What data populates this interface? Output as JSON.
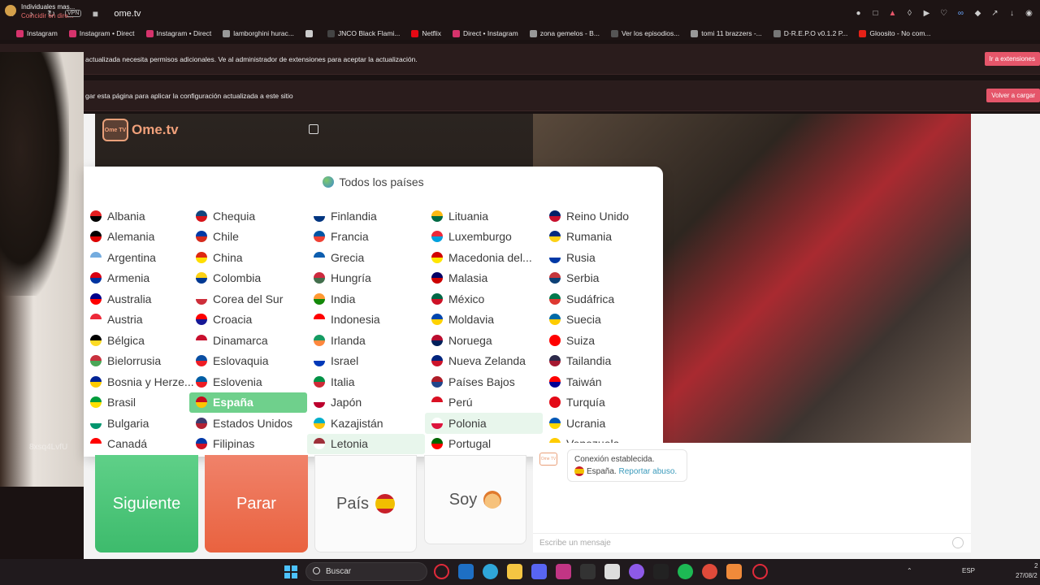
{
  "browser": {
    "url": "ome.tv",
    "vpn_label": "VPN",
    "bookmarks": [
      {
        "label": "Instagram",
        "color": "#d6336c"
      },
      {
        "label": "Instagram • Direct",
        "color": "#d6336c"
      },
      {
        "label": "Instagram • Direct",
        "color": "#d6336c"
      },
      {
        "label": "lamborghini hurac...",
        "color": "#999999"
      },
      {
        "label": "",
        "color": "#cccccc"
      },
      {
        "label": "JNCO Black Flami...",
        "color": "#444444"
      },
      {
        "label": "Netflix",
        "color": "#e50914"
      },
      {
        "label": "Direct • Instagram",
        "color": "#d6336c"
      },
      {
        "label": "zona gemelos - B...",
        "color": "#999999"
      },
      {
        "label": "Ver los episodios...",
        "color": "#555555"
      },
      {
        "label": "tomi 11 brazzers -...",
        "color": "#999999"
      },
      {
        "label": "D·R.E.P.O v0.1.2 P...",
        "color": "#777777"
      },
      {
        "label": "Gloosito - No com...",
        "color": "#e62117"
      }
    ]
  },
  "infobars": {
    "extensions_text": "actualizada necesita permisos adicionales. Ve al administrador de extensiones para aceptar la actualización.",
    "extensions_button": "Ir a extensiones",
    "reload_text": "gar esta página para aplicar la configuración actualizada a este sitio",
    "reload_button": "Volver a cargar"
  },
  "logo": {
    "tv_label": "Ome TV",
    "text": "Ome.tv"
  },
  "webcam": {
    "code": "8xsq4LvfU"
  },
  "countries": {
    "header": "Todos los países",
    "selected": "España",
    "hover": "Polonia",
    "hover2": "Letonia",
    "columns": [
      [
        {
          "name": "Albania",
          "c1": "#e41e20",
          "c2": "#000000"
        },
        {
          "name": "Alemania",
          "c1": "#000000",
          "c2": "#dd0000"
        },
        {
          "name": "Argentina",
          "c1": "#74acdf",
          "c2": "#ffffff"
        },
        {
          "name": "Armenia",
          "c1": "#d90012",
          "c2": "#0033a0"
        },
        {
          "name": "Australia",
          "c1": "#00008b",
          "c2": "#ff0000"
        },
        {
          "name": "Austria",
          "c1": "#ed2939",
          "c2": "#ffffff"
        },
        {
          "name": "Bélgica",
          "c1": "#000000",
          "c2": "#fdda24"
        },
        {
          "name": "Bielorrusia",
          "c1": "#c8313e",
          "c2": "#4aa657"
        },
        {
          "name": "Bosnia y Herze...",
          "c1": "#002395",
          "c2": "#fecb00"
        },
        {
          "name": "Brasil",
          "c1": "#009c3b",
          "c2": "#ffdf00"
        },
        {
          "name": "Bulgaria",
          "c1": "#ffffff",
          "c2": "#00966e"
        },
        {
          "name": "Canadá",
          "c1": "#ff0000",
          "c2": "#ffffff"
        }
      ],
      [
        {
          "name": "Chequia",
          "c1": "#11457e",
          "c2": "#d7141a"
        },
        {
          "name": "Chile",
          "c1": "#0039a6",
          "c2": "#d52b1e"
        },
        {
          "name": "China",
          "c1": "#de2910",
          "c2": "#ffde00"
        },
        {
          "name": "Colombia",
          "c1": "#fcd116",
          "c2": "#003893"
        },
        {
          "name": "Corea del Sur",
          "c1": "#ffffff",
          "c2": "#cd2e3a"
        },
        {
          "name": "Croacia",
          "c1": "#ff0000",
          "c2": "#171796"
        },
        {
          "name": "Dinamarca",
          "c1": "#c8102e",
          "c2": "#ffffff"
        },
        {
          "name": "Eslovaquia",
          "c1": "#0b4ea2",
          "c2": "#ee1c25"
        },
        {
          "name": "Eslovenia",
          "c1": "#005da4",
          "c2": "#ed1c24"
        },
        {
          "name": "España",
          "c1": "#c60b1e",
          "c2": "#ffc400"
        },
        {
          "name": "Estados Unidos",
          "c1": "#3c3b6e",
          "c2": "#b22234"
        },
        {
          "name": "Filipinas",
          "c1": "#0038a8",
          "c2": "#ce1126"
        }
      ],
      [
        {
          "name": "Finlandia",
          "c1": "#ffffff",
          "c2": "#003580"
        },
        {
          "name": "Francia",
          "c1": "#0055a4",
          "c2": "#ef4135"
        },
        {
          "name": "Grecia",
          "c1": "#0d5eaf",
          "c2": "#ffffff"
        },
        {
          "name": "Hungría",
          "c1": "#cd2a3e",
          "c2": "#436f4d"
        },
        {
          "name": "India",
          "c1": "#ff9933",
          "c2": "#138808"
        },
        {
          "name": "Indonesia",
          "c1": "#ff0000",
          "c2": "#ffffff"
        },
        {
          "name": "Irlanda",
          "c1": "#169b62",
          "c2": "#ff883e"
        },
        {
          "name": "Israel",
          "c1": "#ffffff",
          "c2": "#0038b8"
        },
        {
          "name": "Italia",
          "c1": "#009246",
          "c2": "#ce2b37"
        },
        {
          "name": "Japón",
          "c1": "#ffffff",
          "c2": "#bc002d"
        },
        {
          "name": "Kazajistán",
          "c1": "#00afca",
          "c2": "#fec50c"
        },
        {
          "name": "Letonia",
          "c1": "#9e3039",
          "c2": "#ffffff"
        }
      ],
      [
        {
          "name": "Lituania",
          "c1": "#fdb913",
          "c2": "#006a44"
        },
        {
          "name": "Luxemburgo",
          "c1": "#ed2939",
          "c2": "#00a1de"
        },
        {
          "name": "Macedonia del...",
          "c1": "#d20000",
          "c2": "#ffe600"
        },
        {
          "name": "Malasia",
          "c1": "#010066",
          "c2": "#cc0001"
        },
        {
          "name": "México",
          "c1": "#006847",
          "c2": "#ce1126"
        },
        {
          "name": "Moldavia",
          "c1": "#0046ae",
          "c2": "#ffd200"
        },
        {
          "name": "Noruega",
          "c1": "#ba0c2f",
          "c2": "#00205b"
        },
        {
          "name": "Nueva Zelanda",
          "c1": "#00247d",
          "c2": "#cc142b"
        },
        {
          "name": "Países Bajos",
          "c1": "#ae1c28",
          "c2": "#21468b"
        },
        {
          "name": "Perú",
          "c1": "#d91023",
          "c2": "#ffffff"
        },
        {
          "name": "Polonia",
          "c1": "#ffffff",
          "c2": "#dc143c"
        },
        {
          "name": "Portugal",
          "c1": "#006600",
          "c2": "#ff0000"
        }
      ],
      [
        {
          "name": "Reino Unido",
          "c1": "#012169",
          "c2": "#c8102e"
        },
        {
          "name": "Rumania",
          "c1": "#002b7f",
          "c2": "#fcd116"
        },
        {
          "name": "Rusia",
          "c1": "#ffffff",
          "c2": "#0039a6"
        },
        {
          "name": "Serbia",
          "c1": "#c6363c",
          "c2": "#0c4076"
        },
        {
          "name": "Sudáfrica",
          "c1": "#007a4d",
          "c2": "#de3831"
        },
        {
          "name": "Suecia",
          "c1": "#006aa7",
          "c2": "#fecc00"
        },
        {
          "name": "Suiza",
          "c1": "#ff0000",
          "c2": "#ff0000"
        },
        {
          "name": "Tailandia",
          "c1": "#2d2a4a",
          "c2": "#a51931"
        },
        {
          "name": "Taiwán",
          "c1": "#fe0000",
          "c2": "#000095"
        },
        {
          "name": "Turquía",
          "c1": "#e30a17",
          "c2": "#e30a17"
        },
        {
          "name": "Ucrania",
          "c1": "#0057b7",
          "c2": "#ffd700"
        },
        {
          "name": "Venezuela",
          "c1": "#ffcc00",
          "c2": "#00247d"
        }
      ]
    ]
  },
  "buttons": {
    "next": "Siguiente",
    "stop": "Parar",
    "country": "País",
    "soy": "Soy"
  },
  "chat": {
    "avatar_label": "Ome TV",
    "line1": "Conexión establecida.",
    "line2_country": "España.",
    "line2_link": "Reportar abuso.",
    "placeholder": "Escribe un mensaje"
  },
  "taskbar": {
    "notice_title": "Individuales mas...",
    "notice_sub": "Coincidir en dire...",
    "search_label": "Buscar",
    "lang": "ESP",
    "time": "2",
    "date": "27/08/2"
  }
}
